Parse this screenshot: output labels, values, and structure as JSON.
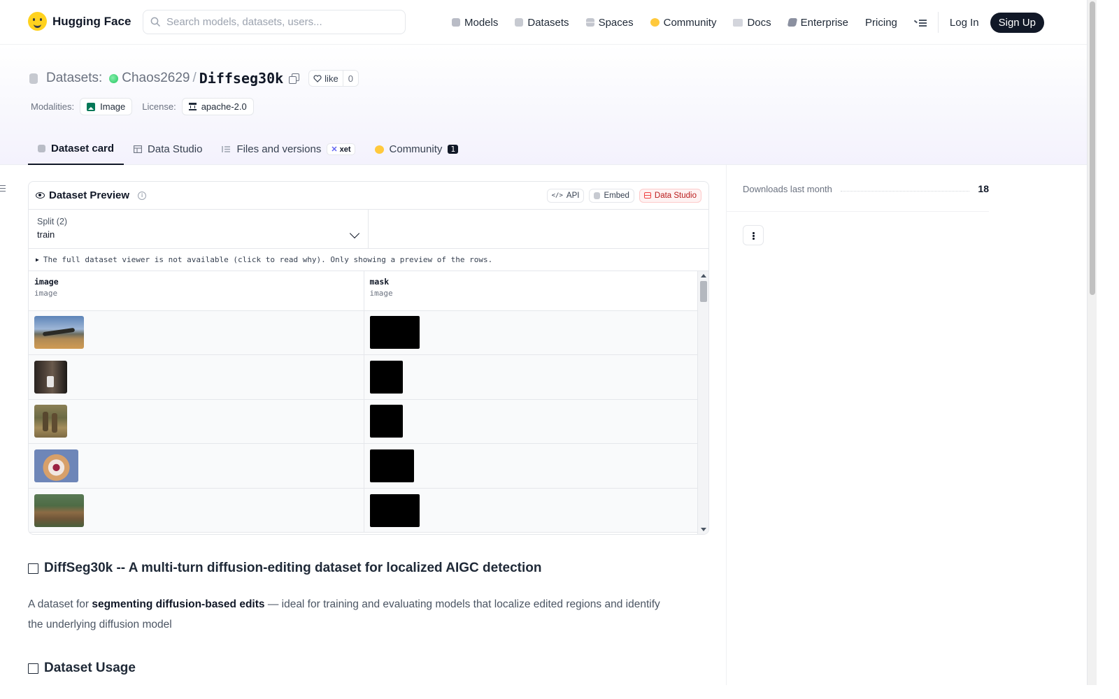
{
  "nav": {
    "logo_text": "Hugging Face",
    "search_placeholder": "Search models, datasets, users...",
    "links": [
      "Models",
      "Datasets",
      "Spaces",
      "Community",
      "Docs",
      "Enterprise",
      "Pricing"
    ],
    "login": "Log In",
    "signup": "Sign Up"
  },
  "header": {
    "crumb_label": "Datasets:",
    "owner": "Chaos2629",
    "separator": "/",
    "dataset_name": "Diffseg30k",
    "like_label": "like",
    "like_count": "0",
    "modalities_label": "Modalities:",
    "modality": "Image",
    "license_label": "License:",
    "license": "apache-2.0"
  },
  "tabs": {
    "dataset_card": "Dataset card",
    "data_studio": "Data Studio",
    "files": "Files and versions",
    "xet": "xet",
    "community": "Community",
    "community_count": "1"
  },
  "preview": {
    "title": "Dataset Preview",
    "api": "API",
    "embed": "Embed",
    "studio": "Data Studio",
    "split_label": "Split (2)",
    "split_value": "train",
    "notice": "The full dataset viewer is not available (click to read why). Only showing a preview of the rows.",
    "columns": [
      {
        "name": "image",
        "type": "image"
      },
      {
        "name": "mask",
        "type": "image"
      }
    ]
  },
  "article": {
    "heading1": "DiffSeg30k -- A multi-turn diffusion-editing dataset for localized AIGC detection",
    "para_prefix": "A dataset for ",
    "para_bold": "segmenting diffusion-based edits",
    "para_suffix": " — ideal for training and evaluating models that localize edited regions and identify the underlying diffusion model",
    "heading2": "Dataset Usage"
  },
  "sidebar": {
    "downloads_label": "Downloads last month",
    "downloads_value": "18"
  },
  "colors": {
    "accent_dark": "#111827",
    "studio_red": "#ef4444"
  }
}
